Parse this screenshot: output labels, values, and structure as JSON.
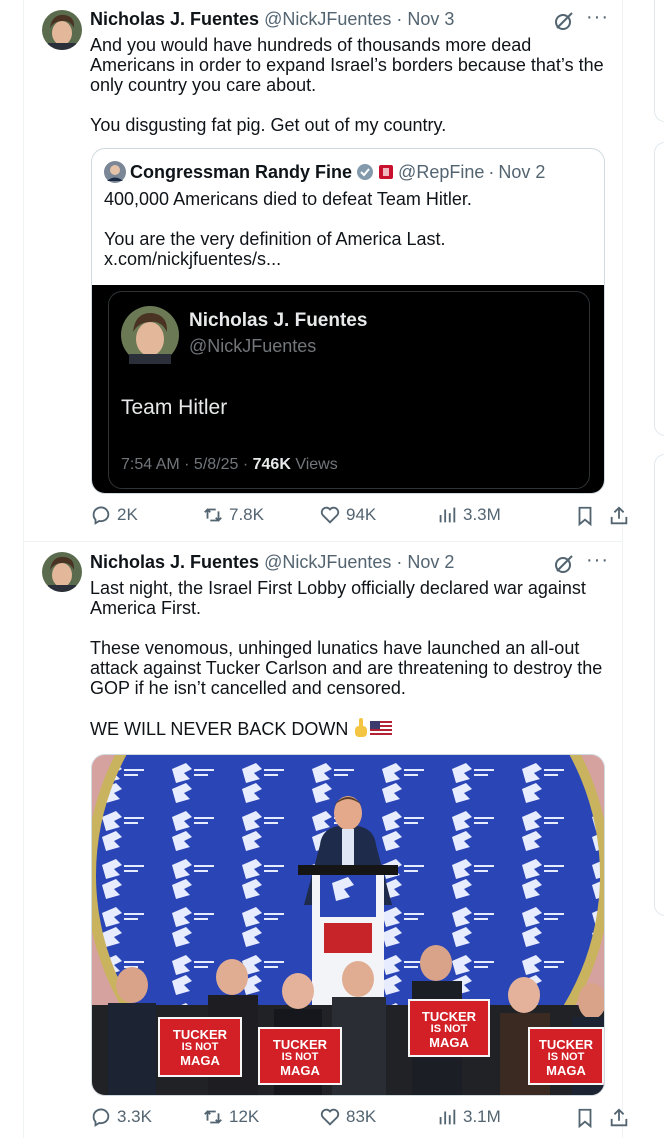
{
  "tweets": [
    {
      "author": "Nicholas J. Fuentes",
      "handle": "@NickJFuentes",
      "date": "Nov 3",
      "text": [
        "And you would have hundreds of thousands more dead Americans in order to expand Israel’s borders because that’s the only country you care about.",
        "You disgusting fat pig. Get out of my country."
      ],
      "quote": {
        "author": "Congressman Randy Fine",
        "handle": "@RepFine",
        "date": "Nov 2",
        "text": [
          "400,000 Americans died to defeat Team Hitler.",
          "You are the very definition of America Last.",
          "x.com/nickjfuentes/s..."
        ],
        "embedded": {
          "author": "Nicholas J. Fuentes",
          "handle": "@NickJFuentes",
          "text": "Team Hitler",
          "time": "7:54 AM · 5/8/25 · ",
          "views_count": "746K",
          "views_label": " Views"
        }
      },
      "stats": {
        "replies": "2K",
        "reposts": "7.8K",
        "likes": "94K",
        "views": "3.3M"
      }
    },
    {
      "author": "Nicholas J. Fuentes",
      "handle": "@NickJFuentes",
      "date": "Nov 2",
      "text": [
        "Last night, the Israel First Lobby officially declared war against America First.",
        "These venomous, unhinged lunatics have launched an all-out attack against Tucker Carlson and are threatening to destroy the GOP if he isn’t cancelled and censored.",
        "WE WILL NEVER BACK DOWN"
      ],
      "photo_signs": [
        {
          "l1": "TUCKER",
          "l2": "IS NOT",
          "l3": "MAGA"
        },
        {
          "l1": "TUCKER",
          "l2": "IS NOT",
          "l3": "MAGA"
        },
        {
          "l1": "TUCKER",
          "l2": "IS NOT",
          "l3": "MAGA"
        },
        {
          "l1": "TUCKER",
          "l2": "IS NOT",
          "l3": "MAGA"
        }
      ],
      "stats": {
        "replies": "3.3K",
        "reposts": "12K",
        "likes": "83K",
        "views": "3.1M"
      }
    }
  ],
  "colors": {
    "text": "#0f1419",
    "muted": "#536471",
    "border": "#cfd9de",
    "verified": "#829aab"
  }
}
